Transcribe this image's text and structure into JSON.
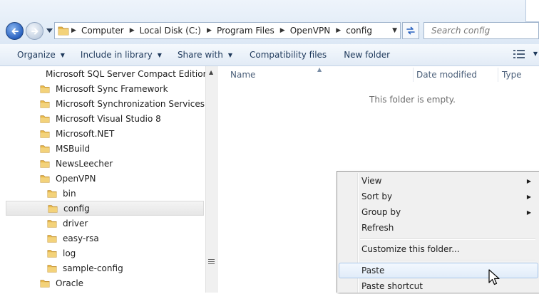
{
  "address_bar": {
    "crumbs": [
      "Computer",
      "Local Disk (C:)",
      "Program Files",
      "OpenVPN",
      "config"
    ]
  },
  "search": {
    "placeholder": "Search config"
  },
  "command_bar": {
    "organize": "Organize",
    "include_in_library": "Include in library",
    "share_with": "Share with",
    "compatibility_files": "Compatibility files",
    "new_folder": "New folder"
  },
  "nav_tree": {
    "items": [
      {
        "label": "Microsoft SQL Server Compact Edition",
        "level": 0
      },
      {
        "label": "Microsoft Sync Framework",
        "level": 0
      },
      {
        "label": "Microsoft Synchronization Services",
        "level": 0
      },
      {
        "label": "Microsoft Visual Studio 8",
        "level": 0
      },
      {
        "label": "Microsoft.NET",
        "level": 0
      },
      {
        "label": "MSBuild",
        "level": 0
      },
      {
        "label": "NewsLeecher",
        "level": 0
      },
      {
        "label": "OpenVPN",
        "level": 0
      },
      {
        "label": "bin",
        "level": 1
      },
      {
        "label": "config",
        "level": 1,
        "selected": true
      },
      {
        "label": "driver",
        "level": 1
      },
      {
        "label": "easy-rsa",
        "level": 1
      },
      {
        "label": "log",
        "level": 1
      },
      {
        "label": "sample-config",
        "level": 1
      },
      {
        "label": "Oracle",
        "level": 0
      }
    ]
  },
  "content": {
    "columns": {
      "name": "Name",
      "date_modified": "Date modified",
      "type": "Type"
    },
    "empty_message": "This folder is empty."
  },
  "context_menu": {
    "view": "View",
    "sort_by": "Sort by",
    "group_by": "Group by",
    "refresh": "Refresh",
    "customize": "Customize this folder...",
    "paste": "Paste",
    "paste_shortcut": "Paste shortcut"
  },
  "colors": {
    "accent": "#2a62c0",
    "folder": "#e8b94a",
    "command_text": "#1e395b",
    "header_text": "#4c607a"
  }
}
